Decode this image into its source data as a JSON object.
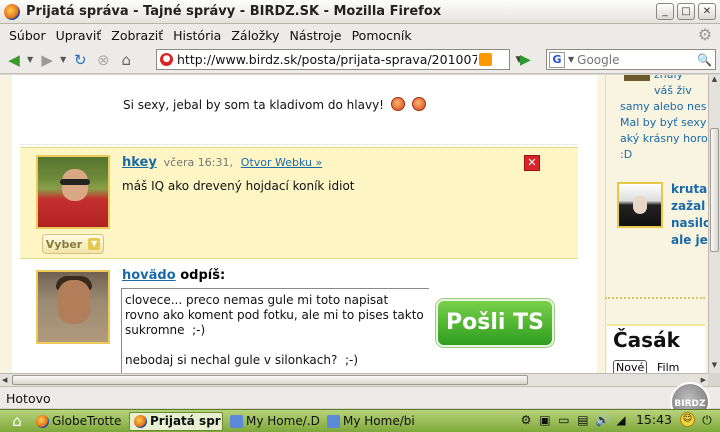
{
  "window": {
    "title": "Prijatá správa - Tajné správy - BIRDZ.SK - Mozilla Firefox",
    "minimize": "_",
    "maximize": "□",
    "close": "✕"
  },
  "menu": {
    "items": [
      {
        "label": "Súbor"
      },
      {
        "label": "Upraviť"
      },
      {
        "label": "Zobraziť"
      },
      {
        "label": "História"
      },
      {
        "label": "Záložky"
      },
      {
        "label": "Nástroje"
      },
      {
        "label": "Pomocník"
      }
    ]
  },
  "navbar": {
    "url": "http://www.birdz.sk/posta/prijata-sprava/201007",
    "search_placeholder": "Google",
    "search_engine_letter": "G"
  },
  "icons": {
    "back": "back-arrow-icon",
    "forward": "forward-arrow-icon",
    "reload": "reload-icon",
    "stop": "stop-icon",
    "home": "home-icon"
  },
  "messages": {
    "first_text": "Si sexy, jebal by som ta kladivom do hlavy!",
    "received": {
      "author": "hkey",
      "time": "včera 16:31,",
      "open_link": "Otvor Webku »",
      "text": "máš IQ ako drevený hojdací koník idiot",
      "select_label": "Vyber"
    },
    "reply": {
      "author": "hovädo",
      "action": "odpíš:",
      "body": "clovece... preco nemas gule mi toto napisat rovno ako koment pod fotku, ale mi to pises takto sukromne  ;-)\n\nnebodaj si nechal gule v silonkach?  ;-)",
      "send_label": "Pošli TS"
    }
  },
  "sidebar": {
    "lines": [
      "znalý",
      "váš živ",
      "samy alebo nes",
      "Mal by byť sexy",
      "aký krásny horo",
      ":D"
    ],
    "bold_lines": [
      "kruta",
      "zažal",
      "nasilo",
      "ale je"
    ],
    "casak": {
      "title": "Časák",
      "tab_new": "Nové",
      "tab_film": "Film"
    }
  },
  "statusbar": {
    "text": "Hotovo",
    "badge": "BIRDZ"
  },
  "taskbar": {
    "tasks": [
      {
        "label": "GlobeTrotte",
        "active": false
      },
      {
        "label": "Prijatá spr",
        "active": true
      },
      {
        "label": "My Home/.D",
        "active": false
      },
      {
        "label": "My Home/bi",
        "active": false
      }
    ],
    "clock": "15:43"
  }
}
